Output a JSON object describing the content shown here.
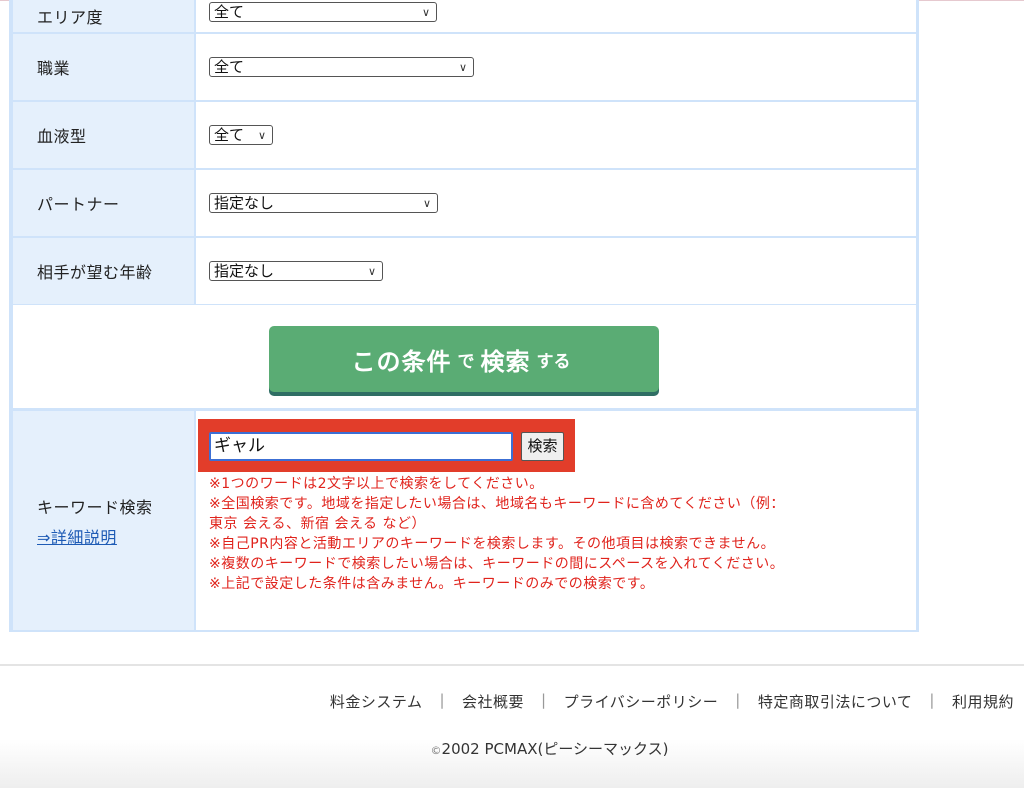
{
  "form": {
    "rows": [
      {
        "label": "エリア度",
        "select_value": "全て"
      },
      {
        "label": "職業",
        "select_value": "全て"
      },
      {
        "label": "血液型",
        "select_value": "全て"
      },
      {
        "label": "パートナー",
        "select_value": "指定なし"
      },
      {
        "label": "相手が望む年齢",
        "select_value": "指定なし"
      }
    ],
    "submit": {
      "part1": "この条件",
      "part2": "で",
      "part3": "検索",
      "part4": "する"
    }
  },
  "keyword": {
    "label": "キーワード検索",
    "help_link": "⇒詳細説明",
    "input_value": "ギャル",
    "button_label": "検索",
    "notes": [
      "※1つのワードは2文字以上で検索をしてください。",
      "※全国検索です。地域を指定したい場合は、地域名もキーワードに含めてください（例：",
      "東京 会える、新宿 会える など）",
      "※自己PR内容と活動エリアのキーワードを検索します。その他項目は検索できません。",
      "※複数のキーワードで検索したい場合は、キーワードの間にスペースを入れてください。",
      "※上記で設定した条件は含みません。キーワードのみでの検索です。"
    ]
  },
  "footer": {
    "links": [
      "料金システム",
      "会社概要",
      "プライバシーポリシー",
      "特定商取引法について",
      "利用規約"
    ],
    "separator": "|",
    "copyright_mark": "©",
    "copyright_text": "2002 PCMAX(ピーシーマックス)"
  },
  "icons": {
    "select_arrow": "chevron-down-icon"
  },
  "colors": {
    "button_green": "#5aac74",
    "note_red": "#e0231c",
    "highlight_red": "#e23d2a",
    "panel_blue": "#cfe3fa"
  }
}
